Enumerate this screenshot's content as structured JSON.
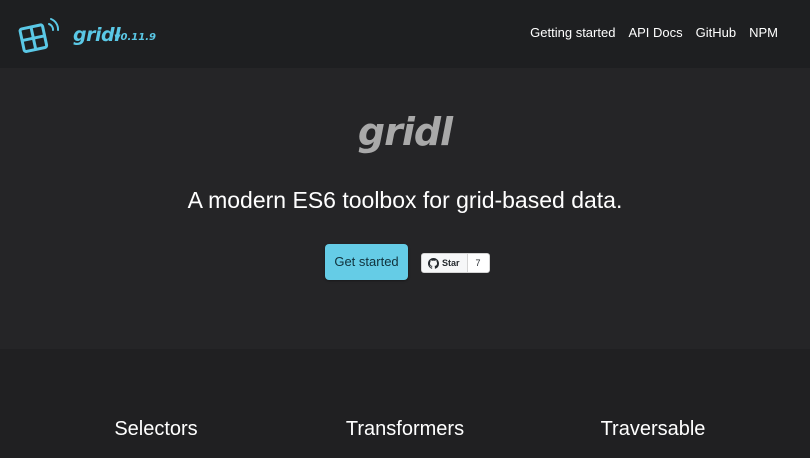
{
  "navbar": {
    "brand": "gridl",
    "version": "v0.11.9",
    "links": [
      "Getting started",
      "API Docs",
      "GitHub",
      "NPM"
    ]
  },
  "hero": {
    "title": "gridl",
    "tagline": "A modern ES6 toolbox for grid-based data.",
    "cta_label": "Get started",
    "star_label": "Star",
    "star_count": "7"
  },
  "features": {
    "titles": [
      "Selectors",
      "Transformers",
      "Traversable"
    ]
  },
  "colors": {
    "accent": "#5ac8e6",
    "button": "#65cce6",
    "nav_background": "#1e1f21",
    "hero_background": "#252527",
    "features_background": "#202022"
  },
  "icons": {
    "logo": "grid-wifi-logo-icon",
    "github": "github-icon"
  }
}
